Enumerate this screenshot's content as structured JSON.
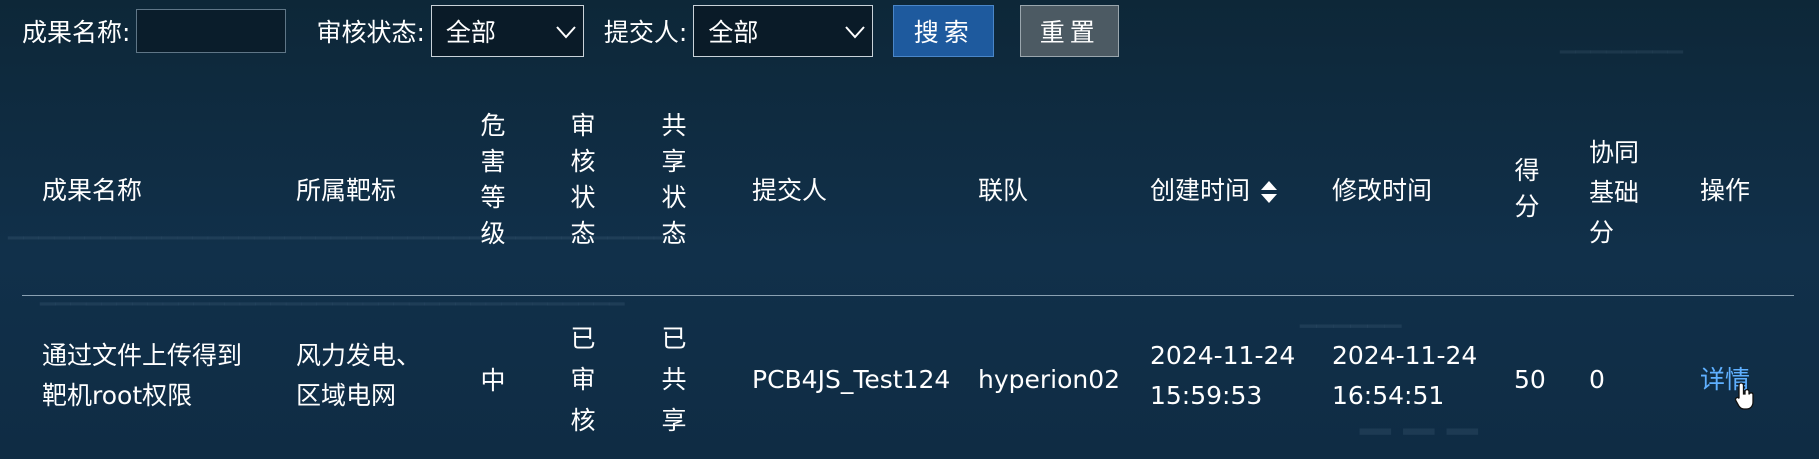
{
  "search": {
    "name_label": "成果名称:",
    "name_value": "",
    "status_label": "审核状态:",
    "status_value": "全部",
    "submitter_label": "提交人:",
    "submitter_value": "全部",
    "search_button": "搜索",
    "reset_button": "重置"
  },
  "table": {
    "headers": {
      "name": "成果名称",
      "target": "所属靶标",
      "hazard": [
        "危",
        "害",
        "等",
        "级"
      ],
      "review": [
        "审",
        "核",
        "状",
        "态"
      ],
      "share": [
        "共",
        "享",
        "状",
        "态"
      ],
      "submitter": "提交人",
      "team": "联队",
      "created": "创建时间",
      "modified": "修改时间",
      "score": [
        "得",
        "分"
      ],
      "collab": [
        "协同",
        "基础",
        "分"
      ],
      "action": "操作"
    },
    "rows": [
      {
        "name": [
          "通过文件上传得到",
          "靶机root权限"
        ],
        "target": [
          "风力发电、",
          "区域电网"
        ],
        "hazard": "中",
        "review": [
          "已",
          "审",
          "核"
        ],
        "share": [
          "已",
          "共",
          "享"
        ],
        "submitter": "PCB4JS_Test124",
        "team": "hyperion02",
        "created": [
          "2024-11-24",
          "15:59:53"
        ],
        "modified": [
          "2024-11-24",
          "16:54:51"
        ],
        "score": "50",
        "collab": "0",
        "action": "详情"
      }
    ]
  },
  "colors": {
    "background": "#0f2a3d",
    "search_button": "#1e5a9e",
    "reset_button": "#4c5a63",
    "link": "#5fb0ff",
    "text": "#ffffff"
  },
  "icons": {
    "select_arrow": "chevron-down-icon",
    "sort": "sort-icon",
    "pointer": "cursor-icon"
  }
}
